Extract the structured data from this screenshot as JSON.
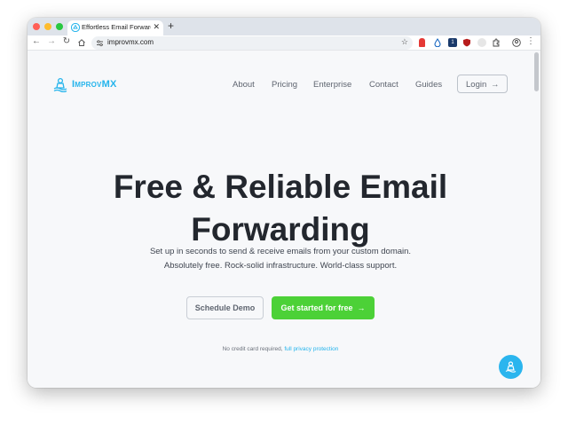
{
  "browser": {
    "tab_title": "Effortless Email Forwarding",
    "url": "improvmx.com",
    "new_tab_icon": "plus-icon",
    "colors": {
      "traffic_red": "#ff5f57",
      "traffic_yellow": "#febc2e",
      "traffic_green": "#28c840"
    }
  },
  "header": {
    "logo_text": "ImprovMX",
    "nav": [
      "About",
      "Pricing",
      "Enterprise",
      "Contact",
      "Guides"
    ],
    "login_label": "Login",
    "login_icon": "arrow-right-icon"
  },
  "hero": {
    "title_line1": "Free & Reliable Email",
    "title_line2": "Forwarding",
    "subtitle_line1": "Set up in seconds to send & receive emails from your custom domain.",
    "subtitle_line2": "Absolutely free. Rock-solid infrastructure. World-class support.",
    "demo_label": "Schedule Demo",
    "start_label": "Get started for free",
    "note_prefix": "No credit card required,",
    "note_link": "full privacy protection"
  },
  "colors": {
    "brand": "#25b4ec",
    "cta": "#4cd137",
    "title": "#23272e",
    "page_bg": "#f7f8fa"
  }
}
